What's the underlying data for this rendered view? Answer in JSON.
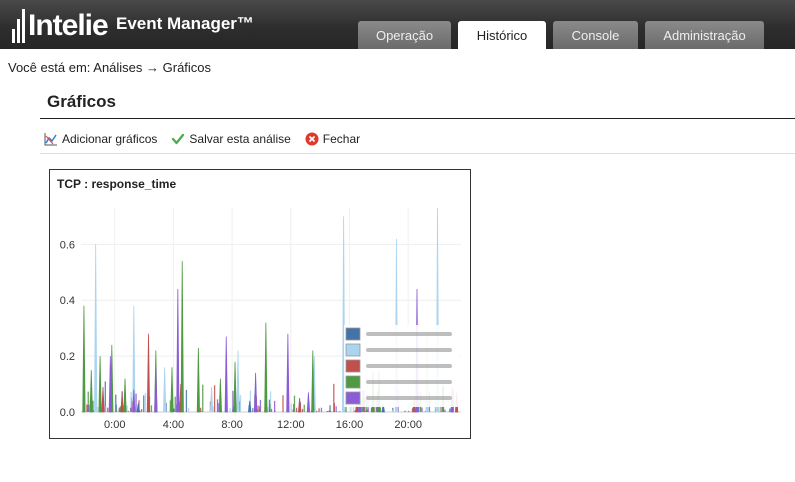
{
  "app": {
    "logo_text": "Intelie",
    "title": "Event Manager™"
  },
  "tabs": [
    {
      "label": "Operação",
      "active": false
    },
    {
      "label": "Histórico",
      "active": true
    },
    {
      "label": "Console",
      "active": false
    },
    {
      "label": "Administração",
      "active": false
    }
  ],
  "breadcrumb": "Você está em: Análises → Gráficos",
  "page": {
    "title": "Gráficos"
  },
  "toolbar": {
    "add_label": "Adicionar gráficos",
    "save_label": "Salvar esta análise",
    "close_label": "Fechar"
  },
  "icons": {
    "add": "chart-add-icon",
    "save": "checkmark-icon",
    "close": "close-circle-icon"
  },
  "chart_data": {
    "type": "bar",
    "title": "TCP : response_time",
    "xlabel": "",
    "ylabel": "",
    "x_ticks": [
      "0:00",
      "4:00",
      "8:00",
      "12:00",
      "16:00",
      "20:00"
    ],
    "y_ticks": [
      "0.0",
      "0.2",
      "0.4",
      "0.6"
    ],
    "ylim": [
      0,
      0.73
    ],
    "xlim_hours": [
      -2.3,
      23.6
    ],
    "grid": true,
    "legend_position": "bottom-right",
    "series": [
      {
        "color": "#4572a7",
        "points": [
          [
            1.6,
            0.03
          ],
          [
            9.2,
            0.04
          ],
          [
            13.5,
            0.05
          ],
          [
            18.3,
            0.03
          ]
        ]
      },
      {
        "color": "#aad4f0",
        "points": [
          [
            -1.3,
            0.6
          ],
          [
            1.3,
            0.38
          ],
          [
            3.4,
            0.16
          ],
          [
            6.6,
            0.09
          ],
          [
            8.4,
            0.22
          ],
          [
            13.6,
            0.2
          ],
          [
            15.6,
            0.7
          ],
          [
            19.2,
            0.62
          ],
          [
            21.3,
            0.3
          ],
          [
            22.0,
            0.73
          ],
          [
            23.0,
            0.06
          ]
        ]
      },
      {
        "color": "#c0504d",
        "points": [
          [
            -0.8,
            0.09
          ],
          [
            0.5,
            0.07
          ],
          [
            2.3,
            0.28
          ],
          [
            4.5,
            0.1
          ],
          [
            10.3,
            0.08
          ],
          [
            12.6,
            0.05
          ],
          [
            16.5,
            0.06
          ],
          [
            20.4,
            0.05
          ],
          [
            23.3,
            0.07
          ]
        ]
      },
      {
        "color": "#4f9a42",
        "points": [
          [
            -2.1,
            0.38
          ],
          [
            -1.6,
            0.15
          ],
          [
            -1.0,
            0.2
          ],
          [
            -0.2,
            0.24
          ],
          [
            0.7,
            0.12
          ],
          [
            2.8,
            0.22
          ],
          [
            3.9,
            0.16
          ],
          [
            4.6,
            0.54
          ],
          [
            5.7,
            0.23
          ],
          [
            7.2,
            0.12
          ],
          [
            8.2,
            0.18
          ],
          [
            10.3,
            0.32
          ],
          [
            13.5,
            0.22
          ],
          [
            17.6,
            0.15
          ],
          [
            18.0,
            0.15
          ]
        ]
      },
      {
        "color": "#8b5cd6",
        "points": [
          [
            -0.3,
            0.2
          ],
          [
            1.3,
            0.08
          ],
          [
            2.8,
            0.16
          ],
          [
            4.3,
            0.44
          ],
          [
            7.6,
            0.27
          ],
          [
            9.6,
            0.14
          ],
          [
            11.8,
            0.28
          ],
          [
            13.2,
            0.07
          ],
          [
            16.7,
            0.12
          ],
          [
            20.6,
            0.44
          ],
          [
            23.0,
            0.09
          ]
        ]
      }
    ]
  }
}
